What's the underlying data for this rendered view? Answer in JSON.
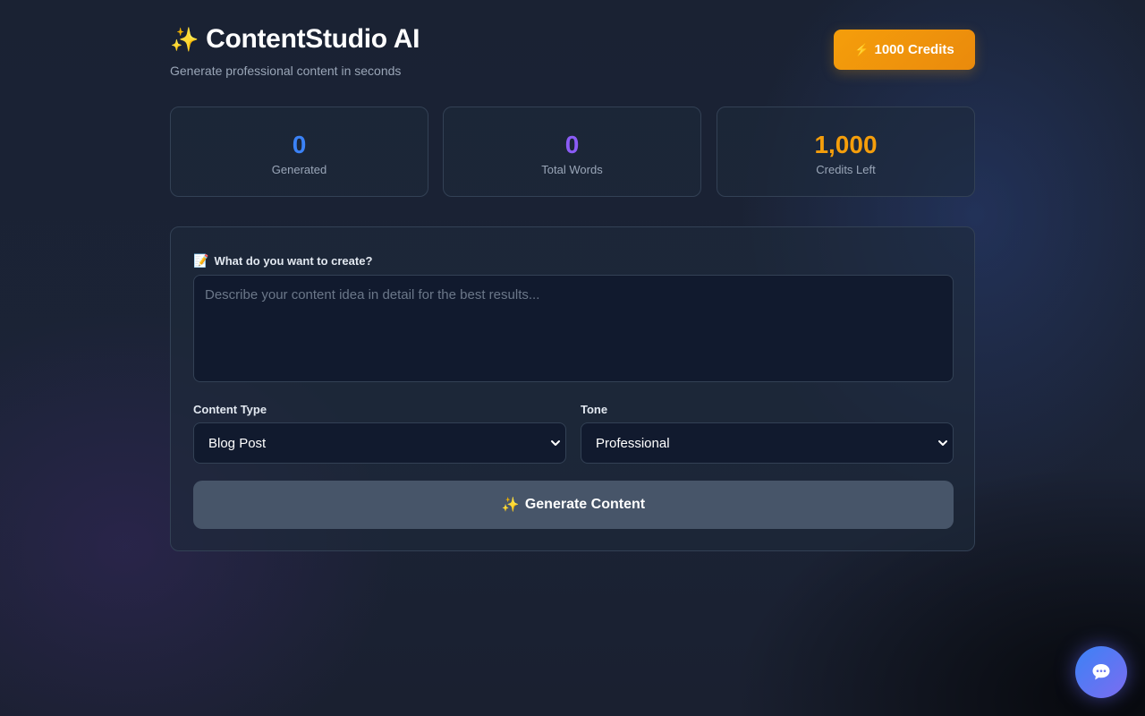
{
  "header": {
    "title_icon": "sparkles-icon",
    "title": "ContentStudio AI",
    "subtitle": "Generate professional content in seconds",
    "credits_button": {
      "icon": "bolt-icon",
      "label": "1000 Credits"
    }
  },
  "stats": [
    {
      "value": "0",
      "label": "Generated",
      "color": "#3b82f6"
    },
    {
      "value": "0",
      "label": "Total Words",
      "color": "#8b5cf6"
    },
    {
      "value": "1,000",
      "label": "Credits Left",
      "color": "#f59e0b"
    }
  ],
  "form": {
    "prompt_icon": "memo-icon",
    "prompt_label": "What do you want to create?",
    "prompt_value": "",
    "prompt_placeholder": "Describe your content idea in detail for the best results...",
    "content_type": {
      "label": "Content Type",
      "selected": "Blog Post"
    },
    "tone": {
      "label": "Tone",
      "selected": "Professional"
    },
    "generate_button": {
      "icon": "sparkles-icon",
      "label": "Generate Content"
    }
  },
  "chat_widget": {
    "icon": "chat-bubble-icon"
  },
  "colors": {
    "accent_orange": "#f59e0b",
    "stat_blue": "#3b82f6",
    "stat_purple": "#8b5cf6",
    "button_disabled": "#475569"
  }
}
